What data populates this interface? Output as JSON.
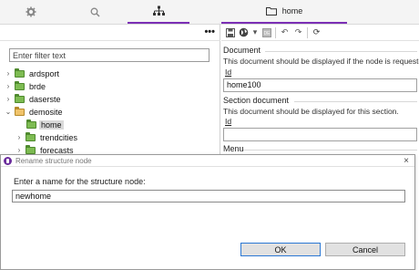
{
  "top_tabs": {
    "left": [
      {
        "name": "settings",
        "icon": "gear-icon"
      },
      {
        "name": "search",
        "icon": "search-icon"
      },
      {
        "name": "structure",
        "icon": "sitemap-icon",
        "active": true
      }
    ],
    "right": {
      "label": "home",
      "icon": "folder-icon"
    }
  },
  "left_pane": {
    "more_label": "•••",
    "filter_placeholder": "Enter filter text",
    "tree": [
      {
        "label": "ardsport",
        "level": 0,
        "expanded": false
      },
      {
        "label": "brde",
        "level": 0,
        "expanded": false
      },
      {
        "label": "daserste",
        "level": 0,
        "expanded": false
      },
      {
        "label": "demosite",
        "level": 0,
        "expanded": true
      },
      {
        "label": "home",
        "level": 1,
        "selected": true
      },
      {
        "label": "trendcities",
        "level": 1,
        "expanded": false
      },
      {
        "label": "forecasts",
        "level": 1,
        "expanded": false
      }
    ]
  },
  "right_pane": {
    "toolbar": [
      "save-icon",
      "globe-icon",
      "publish-icon",
      "undo-icon",
      "redo-icon",
      "refresh-icon"
    ],
    "document_heading": "Document",
    "document_desc": "This document should be displayed if the node is requested d",
    "id_label": "Id",
    "document_id_value": "home100",
    "section_heading": "Section document",
    "section_desc": "This document should be displayed for this section.",
    "section_id_label": "Id",
    "section_id_value": "",
    "menu_heading": "Menu"
  },
  "dialog": {
    "title": "Rename structure node",
    "prompt": "Enter a name for the structure node:",
    "input_value": "newhome",
    "ok_label": "OK",
    "cancel_label": "Cancel",
    "close_label": "×"
  },
  "colors": {
    "accent": "#7b2fb5",
    "folder_green": "#7dbb52",
    "folder_open": "#f0c36a",
    "ok_border": "#2b78d4"
  }
}
